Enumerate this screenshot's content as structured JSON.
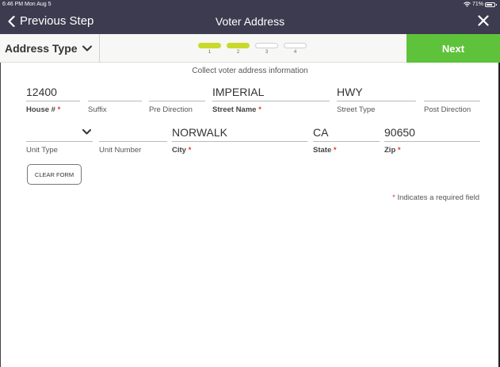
{
  "status": {
    "time": "6:46 PM",
    "date": "Mon Aug 5",
    "battery": "71%",
    "wifi_icon": "wifi-icon",
    "battery_icon": "battery-icon"
  },
  "nav": {
    "back_label": "Previous Step",
    "title": "Voter Address",
    "back_icon": "chevron-left-icon",
    "close_icon": "close-icon"
  },
  "toolbar": {
    "address_type_label": "Address Type",
    "steps": [
      {
        "number": "1",
        "complete": true
      },
      {
        "number": "2",
        "complete": true
      },
      {
        "number": "3",
        "complete": false
      },
      {
        "number": "4",
        "complete": false
      }
    ],
    "next_label": "Next"
  },
  "form": {
    "subtitle": "Collect voter address information",
    "row1": {
      "house_number": {
        "value": "12400",
        "label": "House #",
        "required": true
      },
      "suffix": {
        "value": "",
        "label": "Suffix",
        "required": false
      },
      "pre_direction": {
        "value": "",
        "label": "Pre Direction",
        "required": false
      },
      "street_name": {
        "value": "IMPERIAL",
        "label": "Street Name",
        "required": true
      },
      "street_type": {
        "value": "HWY",
        "label": "Street Type",
        "required": false
      },
      "post_direction": {
        "value": "",
        "label": "Post Direction",
        "required": false
      }
    },
    "row2": {
      "unit_type": {
        "value": "",
        "label": "Unit Type",
        "required": false
      },
      "unit_number": {
        "value": "",
        "label": "Unit Number",
        "required": false
      },
      "city": {
        "value": "NORWALK",
        "label": "City",
        "required": true
      },
      "state": {
        "value": "CA",
        "label": "State",
        "required": true
      },
      "zip": {
        "value": "90650",
        "label": "Zip",
        "required": true
      }
    },
    "required_star": "*",
    "clear_label": "CLEAR FORM",
    "required_note": "Indicates a required field"
  },
  "colors": {
    "header_bg": "#3d3b4f",
    "next_green": "#5ec23a",
    "step_done": "#c9d92a",
    "required_red": "#e53935"
  }
}
